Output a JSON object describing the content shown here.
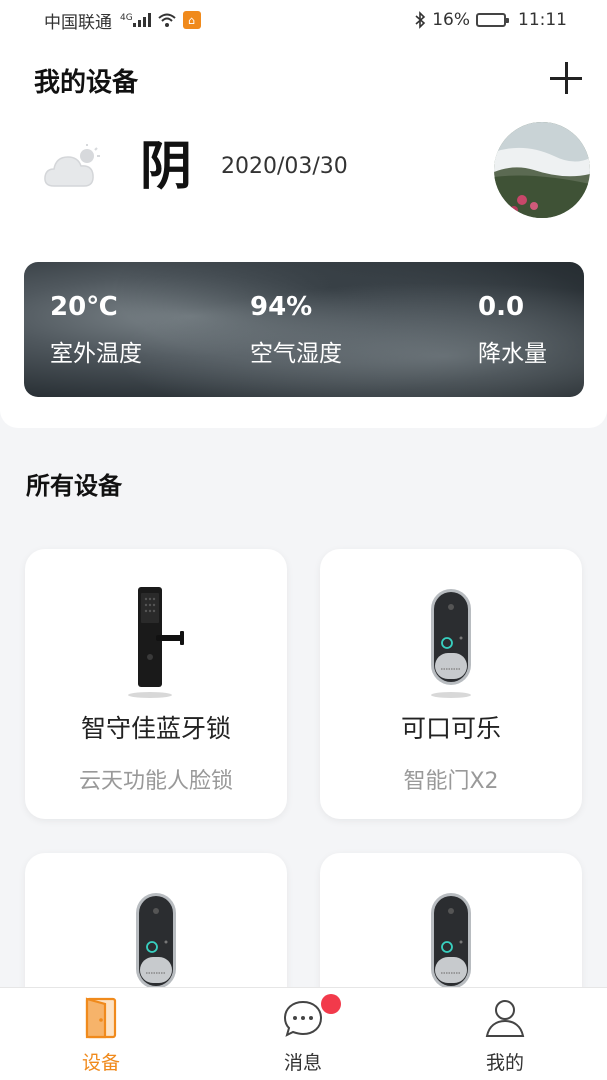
{
  "status_bar": {
    "carrier": "中国联通",
    "network": "4G",
    "battery_percent": "16%",
    "battery_level": 0.16,
    "time": "11:11",
    "icons": [
      "signal-icon",
      "wifi-icon",
      "app-notification-icon",
      "bluetooth-icon",
      "battery-icon"
    ]
  },
  "header": {
    "title": "我的设备",
    "add_icon": "plus-icon"
  },
  "weather": {
    "condition": "阴",
    "icon": "cloudy-icon",
    "date": "2020/03/30"
  },
  "environment": [
    {
      "value": "20℃",
      "label": "室外温度"
    },
    {
      "value": "94%",
      "label": "空气湿度"
    },
    {
      "value": "0.0",
      "label": "降水量"
    }
  ],
  "devices_section": {
    "title": "所有设备",
    "devices": [
      {
        "name": "智守佳蓝牙锁",
        "model": "云天功能人脸锁",
        "icon": "door-lock-icon"
      },
      {
        "name": "可口可乐",
        "model": "智能门X2",
        "icon": "video-doorbell-icon"
      },
      {
        "name": "",
        "model": "",
        "icon": "video-doorbell-icon"
      },
      {
        "name": "",
        "model": "",
        "icon": "video-doorbell-icon"
      }
    ]
  },
  "bottom_nav": {
    "items": [
      {
        "label": "设备",
        "icon": "door-icon",
        "active": true
      },
      {
        "label": "消息",
        "icon": "message-icon",
        "active": false,
        "has_badge": true
      },
      {
        "label": "我的",
        "icon": "user-icon",
        "active": false
      }
    ]
  },
  "colors": {
    "accent": "#f08a1c",
    "badge": "#f23a4b",
    "background": "#f4f5f7"
  }
}
